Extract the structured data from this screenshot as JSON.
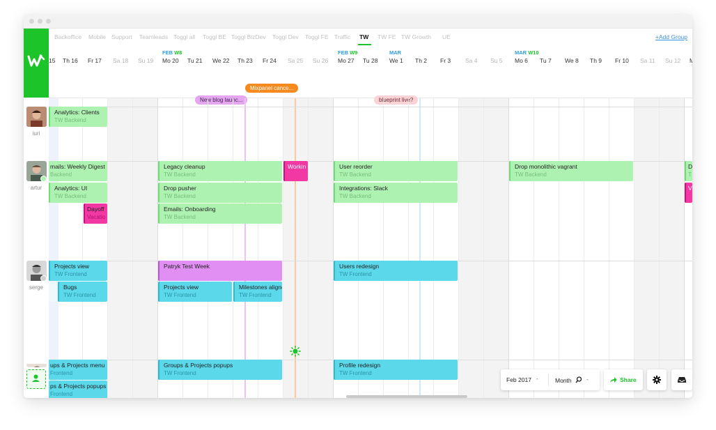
{
  "tabs": [
    "Backoffice",
    "Mobile",
    "Support",
    "Teamleads",
    "Toggl all",
    "Toggl BE",
    "Toggl BizDev",
    "Toggl Dev",
    "Toggl FE",
    "Traffic",
    "TW",
    "TW FE",
    "TW Growth",
    "UE"
  ],
  "active_tab": "TW",
  "add_group_label": "+Add Group",
  "weeks": [
    {
      "month": "FEB",
      "week": "W8"
    },
    {
      "month": "FEB",
      "week": "W9"
    },
    {
      "month": "MAR",
      "week": ""
    },
    {
      "month": "MAR",
      "week": "W10"
    }
  ],
  "days": [
    "15",
    "Th 16",
    "Fr 17",
    "Sa 18",
    "Su 19",
    "Mo 20",
    "Tu 21",
    "We 22",
    "Th 23",
    "Fr 24",
    "Sa 25",
    "Su 26",
    "Mo 27",
    "Tu 28",
    "We 1",
    "Th 2",
    "Fr 3",
    "Sa 4",
    "Su 5",
    "Mo 6",
    "Tu 7",
    "We 8",
    "Th 9",
    "Fr 10",
    "Sa 11",
    "Su 12",
    "M"
  ],
  "milestones": [
    {
      "label": "Mixpanel cance...",
      "color": "#f68a1e",
      "text_color": "#ffffff"
    },
    {
      "label": "New blog launc...",
      "color": "#e3a6ef",
      "text_color": "#4a2458"
    },
    {
      "label": "blueprint live?",
      "color": "#fbd3d7",
      "text_color": "#6a2a30"
    }
  ],
  "users": [
    {
      "name": "iuri",
      "tasks": [
        {
          "title": "Analytics: Clients",
          "project": "TW Backend"
        }
      ]
    },
    {
      "name": "artur",
      "tasks": [
        {
          "title": "mails: Weekly Digest",
          "project": "Backend"
        },
        {
          "title": "Analytics: UI",
          "project": "TW Backend"
        },
        {
          "title": "Dayoff",
          "project": "Vacatio"
        },
        {
          "title": "Legacy cleanup",
          "project": "TW Backend"
        },
        {
          "title": "Drop pusher",
          "project": "TW Backend"
        },
        {
          "title": "Emails: Onboarding",
          "project": "TW Backend"
        },
        {
          "title": "Workin",
          "project": ""
        },
        {
          "title": "User reorder",
          "project": "TW Backend"
        },
        {
          "title": "Integrations: Slack",
          "project": "TW Backend"
        },
        {
          "title": "Drop monolithic vagrant",
          "project": "TW Backend"
        },
        {
          "title": "D",
          "project": "T"
        },
        {
          "title": "V",
          "project": ""
        }
      ]
    },
    {
      "name": "serge",
      "tasks": [
        {
          "title": "Projects view",
          "project": "TW Frontend"
        },
        {
          "title": "Bugs",
          "project": "TW Frontend"
        },
        {
          "title": "Patryk Test Week",
          "project": ""
        },
        {
          "title": "Projects view",
          "project": "TW Frontend"
        },
        {
          "title": "Milestones aligne",
          "project": "TW Frontend"
        },
        {
          "title": "Users redesign",
          "project": "TW Frontend"
        }
      ]
    },
    {
      "name": "",
      "tasks": [
        {
          "title": "ups & Projects menu",
          "project": "Frontend"
        },
        {
          "title": "ps & Projects popups",
          "project": "Frontend"
        },
        {
          "title": "Groups & Projects popups",
          "project": "TW Frontend"
        },
        {
          "title": "Profile redesign",
          "project": "TW Frontend"
        }
      ]
    }
  ],
  "toolbar": {
    "date_label": "Feb 2017",
    "zoom_label": "Month",
    "share_label": "Share"
  },
  "colors": {
    "brand": "#1cc42a",
    "green_task": "#aef2b1",
    "cyan_task": "#5bd8ea",
    "pink_task": "#f238a3",
    "purple_task": "#e18ff2",
    "today_line": "#f9c89b"
  }
}
